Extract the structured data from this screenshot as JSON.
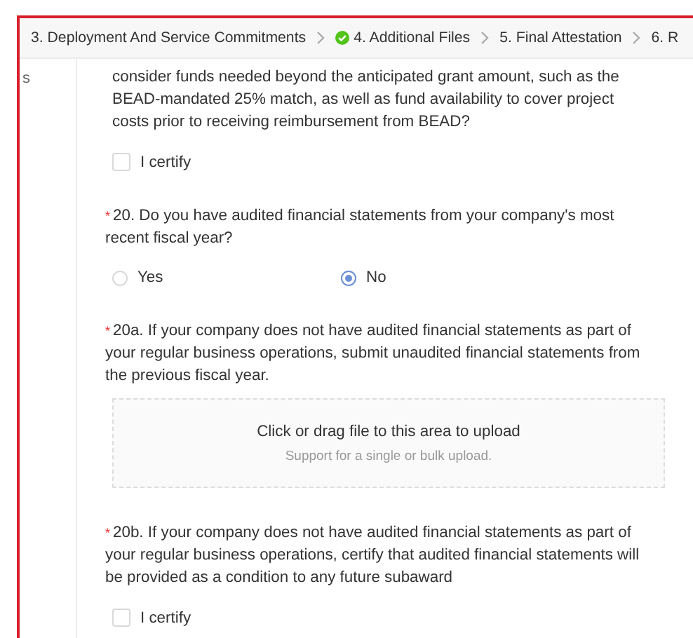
{
  "steps": [
    {
      "label": "3. Deployment And Service Commitments",
      "completed": false
    },
    {
      "label": "4. Additional Files",
      "completed": true
    },
    {
      "label": "5. Final Attestation",
      "completed": false
    },
    {
      "label": "6. R",
      "completed": false
    }
  ],
  "sidebar": {
    "label": "s"
  },
  "form": [
    {
      "kind": "text",
      "text": "consider funds needed beyond the anticipated grant amount, such as the BEAD-mandated 25% match, as well as fund availability to cover project costs prior to receiving reimbursement from BEAD?"
    },
    {
      "kind": "checkbox",
      "label": "I certify",
      "checked": false
    },
    {
      "kind": "question",
      "mark": "*",
      "text": "20. Do you have audited financial statements from your company's most recent fiscal year?"
    },
    {
      "kind": "radio",
      "options": [
        {
          "label": "Yes",
          "selected": false
        },
        {
          "label": "No",
          "selected": true
        }
      ]
    },
    {
      "kind": "question",
      "mark": "*",
      "text": "20a. If your company does not have audited financial statements as part of your regular business operations, submit unaudited financial statements from the previous fiscal year."
    },
    {
      "kind": "upload",
      "title": "Click or drag file to this area to upload",
      "hint": "Support for a single or bulk upload."
    },
    {
      "kind": "question",
      "mark": "*",
      "text": "20b. If your company does not have audited financial statements as part of your regular business operations, certify that audited financial statements will be provided as a condition to any future subaward"
    },
    {
      "kind": "checkbox",
      "label": "I certify",
      "checked": false
    }
  ]
}
